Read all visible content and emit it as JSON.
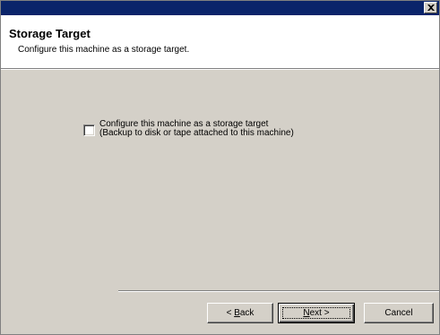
{
  "window": {
    "close_icon": "close-icon"
  },
  "header": {
    "title": "Storage Target",
    "subtitle": "Configure this machine as a storage target."
  },
  "option": {
    "checked": false,
    "line1": "Configure this machine as a storage target",
    "line2": "(Backup to disk or tape attached to this machine)"
  },
  "buttons": {
    "back_prefix": "< ",
    "back_mnemonic": "B",
    "back_rest": "ack",
    "next_mnemonic": "N",
    "next_rest": "ext >",
    "cancel": "Cancel"
  },
  "colors": {
    "titlebar": "#0a246a",
    "dialog_face": "#d4d0c8",
    "header_bg": "#ffffff"
  }
}
